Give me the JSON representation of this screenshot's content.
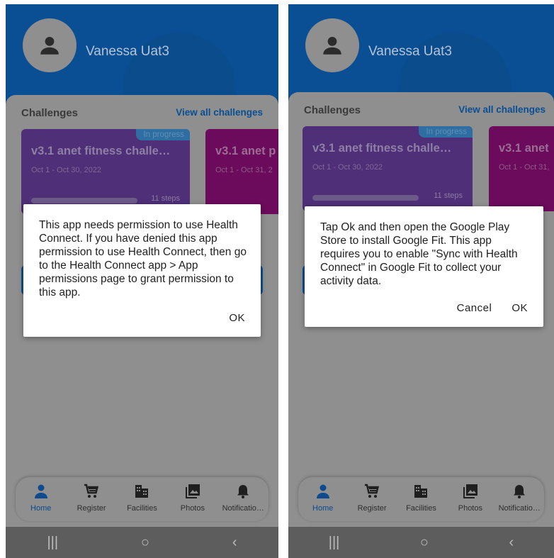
{
  "screens": [
    {
      "user_name": "Vanessa Uat3",
      "challenges_title": "Challenges",
      "view_all": "View all challenges",
      "cards": [
        {
          "badge": "In progress",
          "title": "v3.1 anet fitness challe…",
          "date": "Oct 1 - Oct 30, 2022",
          "steps": "11 steps"
        },
        {
          "title": "v3.1 anet p",
          "date": "Oct 1 - Oct 31, 2"
        }
      ],
      "dialog": {
        "message": "This app needs permission to use Health Connect. If you have denied this app permission to use Health Connect, then go to the Health Connect app > App permissions page to grant permission to this app.",
        "ok": "OK"
      }
    },
    {
      "user_name": "Vanessa Uat3",
      "challenges_title": "Challenges",
      "view_all": "View all challenges",
      "cards": [
        {
          "badge": "In progress",
          "title": "v3.1 anet fitness challe…",
          "date": "Oct 1 - Oct 30, 2022",
          "steps": "11 steps"
        },
        {
          "title": "v3.1 anet",
          "date": "Oct 1 - Oct 31,"
        }
      ],
      "dialog": {
        "message": "Tap Ok and then open the Google Play Store to install Google Fit. This app requires you to enable \"Sync with Health Connect\" in Google Fit to collect your activity data.",
        "cancel": "Cancel",
        "ok": "OK"
      }
    }
  ],
  "nav": [
    {
      "label": "Home",
      "icon": "person-icon"
    },
    {
      "label": "Register",
      "icon": "cart-icon"
    },
    {
      "label": "Facilities",
      "icon": "building-icon"
    },
    {
      "label": "Photos",
      "icon": "photos-icon"
    },
    {
      "label": "Notificatio…",
      "icon": "bell-icon"
    }
  ],
  "system_nav": {
    "recents": "|||",
    "home": "○",
    "back": "‹"
  },
  "colors": {
    "header": "#0a4f93",
    "overlay": "#8f8f8f",
    "active": "#0b4b8e"
  }
}
